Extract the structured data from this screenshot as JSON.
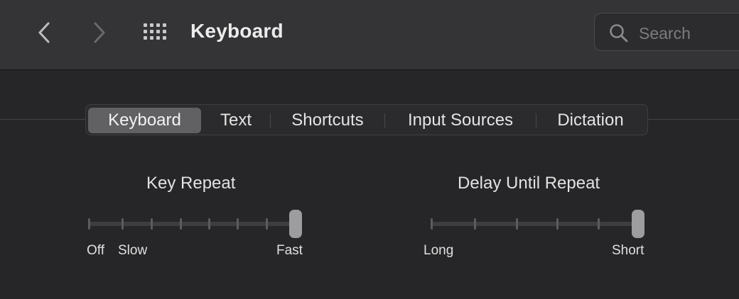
{
  "window": {
    "title": "Keyboard"
  },
  "toolbar": {
    "back_icon": "chevron-left-icon",
    "forward_icon": "chevron-right-icon",
    "grid_icon": "grid-icon",
    "search_placeholder": "Search",
    "search_value": ""
  },
  "tabs": [
    {
      "label": "Keyboard",
      "selected": true
    },
    {
      "label": "Text",
      "selected": false
    },
    {
      "label": "Shortcuts",
      "selected": false
    },
    {
      "label": "Input Sources",
      "selected": false
    },
    {
      "label": "Dictation",
      "selected": false
    }
  ],
  "key_repeat": {
    "title": "Key Repeat",
    "labels": {
      "off": "Off",
      "slow": "Slow",
      "fast": "Fast"
    },
    "steps": 8,
    "selected_step": 8
  },
  "delay_until_repeat": {
    "title": "Delay Until Repeat",
    "labels": {
      "long": "Long",
      "short": "Short"
    },
    "steps": 6,
    "selected_step": 6
  }
}
